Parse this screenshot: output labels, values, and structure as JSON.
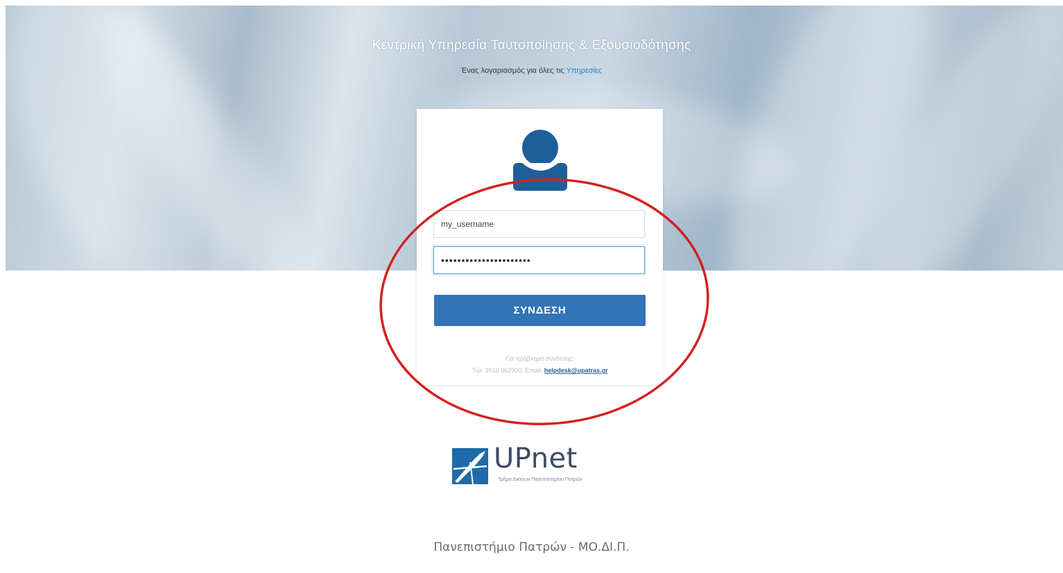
{
  "header": {
    "title": "Κεντρική Υπηρεσία Ταυτοποίησης & Εξουσιοδότησης",
    "subtitle_prefix": "Ένας λογαριασμός για όλες τις ",
    "subtitle_link": "Υπηρεσίες"
  },
  "login": {
    "avatar_icon": "user-icon",
    "username_value": "my_username",
    "password_value": "••••••••••••••••••••••",
    "submit_label": "ΣΥΝΔΕΣΗ",
    "help_title": "Για πρόβλημα σύνδεσης:",
    "help_contact_prefix": "Τηλ: 2610 962900, Email: ",
    "help_email": "helpdesk@upatras.gr"
  },
  "branding": {
    "logo_name": "UPnet",
    "logo_tagline": "Τμήμα Δικτύων Πανεπιστημίου Πατρών"
  },
  "footer": {
    "text": "Πανεπιστήμιο Πατρών - ΜΟ.ΔΙ.Π."
  },
  "colors": {
    "accent": "#3274b8",
    "link": "#2a7fc9",
    "annotation": "#d42020"
  }
}
